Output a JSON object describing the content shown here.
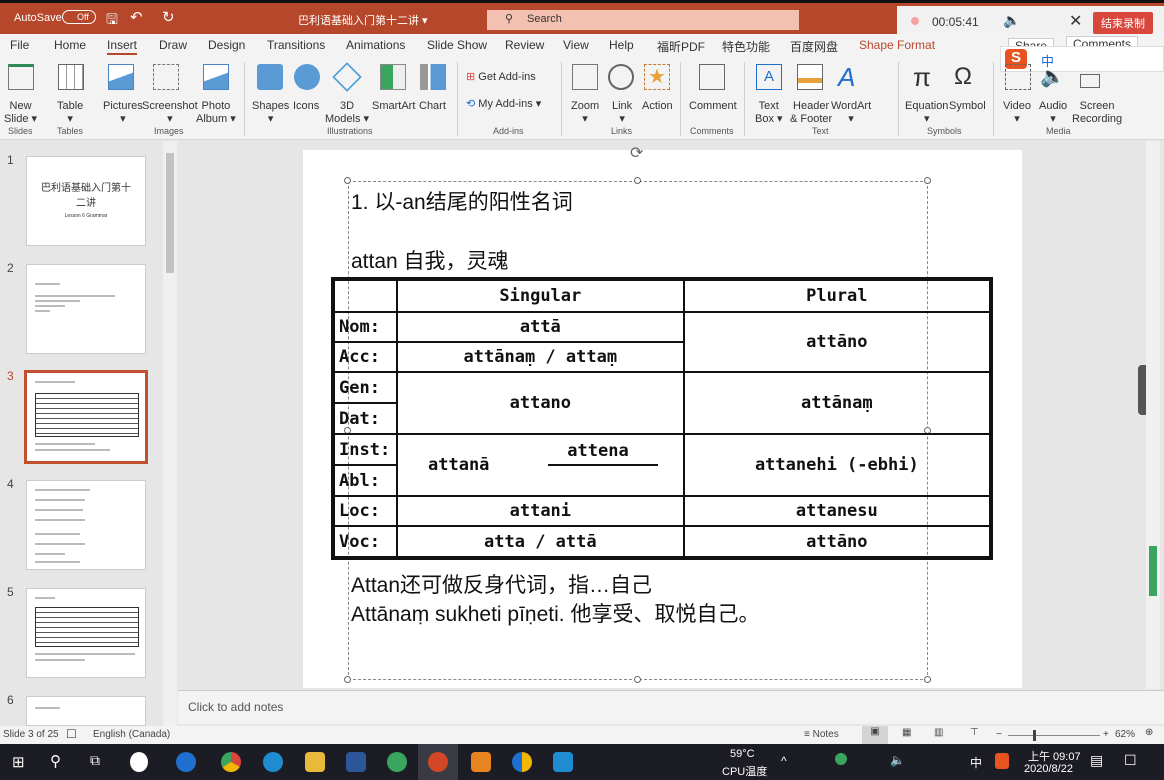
{
  "titlebar": {
    "autosave": "AutoSave",
    "toggle": "Off",
    "doc_title": "巴利语基础入门第十二讲 ▾",
    "search": "Search",
    "timer": "00:05:41",
    "end_record": "结束录制"
  },
  "tabs": [
    "File",
    "Home",
    "Insert",
    "Draw",
    "Design",
    "Transitions",
    "Animations",
    "Slide Show",
    "Review",
    "View",
    "Help",
    "福昕PDF",
    "特色功能",
    "百度网盘",
    "Shape Format"
  ],
  "share": "Share",
  "comments": "Comments",
  "ribbon": {
    "buttons": [
      "New\nSlide ▾",
      "Table\n▾",
      "Pictures\n▾",
      "Screenshot\n▾",
      "Photo\nAlbum ▾",
      "Shapes\n▾",
      "Icons",
      "3D\nModels ▾",
      "SmartArt",
      "Chart",
      "Zoom\n▾",
      "Link\n▾",
      "Action",
      "Comment",
      "Text\nBox ▾",
      "Header\n& Footer",
      "WordArt\n▾",
      "Equation\n▾",
      "Symbol",
      "Video\n▾",
      "Audio\n▾",
      "Screen\nRecording"
    ],
    "get_addins": "Get Add-ins",
    "my_addins": "My Add-ins ▾",
    "groups": [
      "Slides",
      "Tables",
      "Images",
      "Illustrations",
      "Add-ins",
      "Links",
      "Comments",
      "Text",
      "Symbols",
      "Media"
    ]
  },
  "thumbs": [
    "1",
    "2",
    "3",
    "4",
    "5",
    "6"
  ],
  "thumb1_title": "巴利语基础入门第十二讲",
  "thumb1_sub": "Lesson 6 Grammar",
  "slide": {
    "heading": "1. 以-an结尾的阳性名词",
    "word": "attan 自我，灵魂",
    "headers": [
      "Singular",
      "Plural"
    ],
    "cases": [
      "Nom:",
      "Acc:",
      "Gen:",
      "Dat:",
      "Inst:",
      "Abl:",
      "Loc:",
      "Voc:"
    ],
    "sg": {
      "nom": "attā",
      "acc": "attānaṃ / attaṃ",
      "gendat": "attano",
      "inst_a": "attanā",
      "inst_b": "attena",
      "loc": "attani",
      "voc": "atta / attā"
    },
    "pl": {
      "nomacc": "attāno",
      "gendat": "attānaṃ",
      "instabl": "attanehi (-ebhi)",
      "loc": "attanesu",
      "voc": "attāno"
    },
    "line1": "Attan还可做反身代词，指…自己",
    "line2": "Attānaṃ sukheti pīṇeti. 他享受、取悦自己。"
  },
  "notes_placeholder": "Click to add notes",
  "status": {
    "slide": "Slide 3 of 25",
    "lang": "English (Canada)",
    "notes": "Notes",
    "zoom": "62%"
  },
  "taskbar": {
    "temp": "59°C",
    "cpu": "CPU温度",
    "time": "上午 09:07",
    "date": "2020/8/22",
    "ime": "中"
  }
}
